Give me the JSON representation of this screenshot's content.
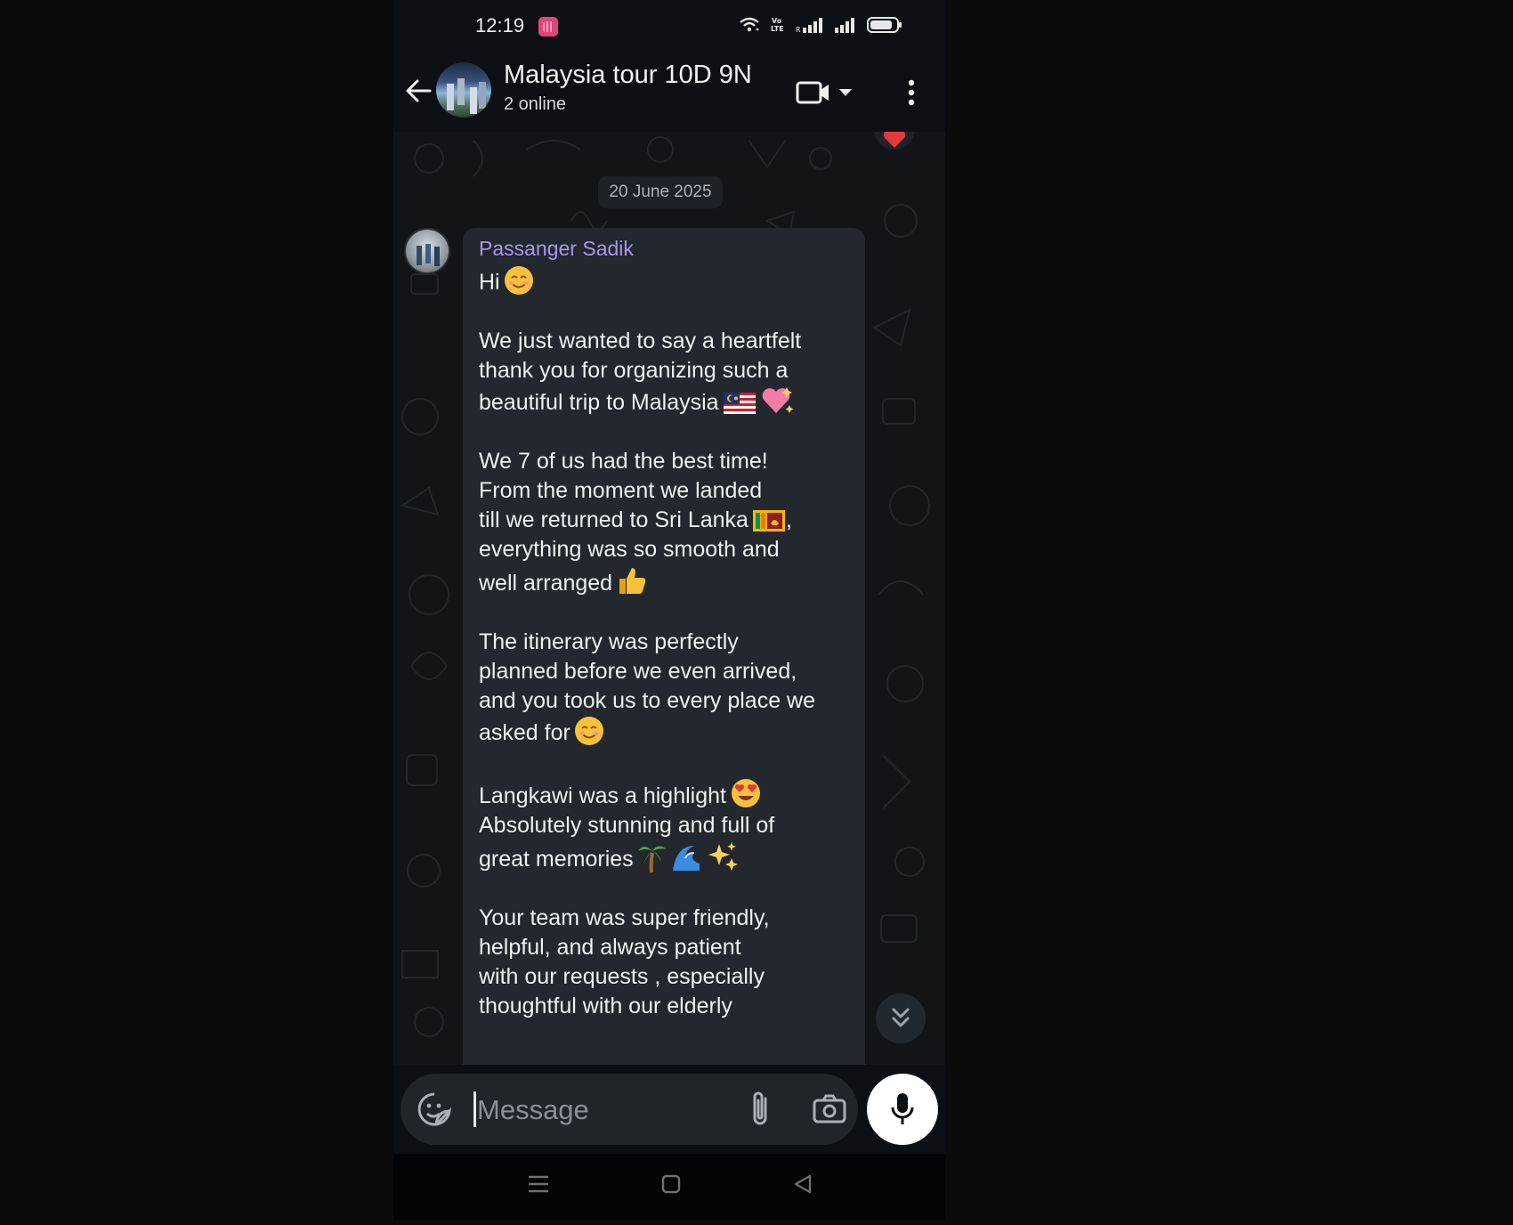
{
  "status_bar": {
    "time": "12:19",
    "icons": [
      "app-notification-icon",
      "wifi-icon",
      "volte-icon",
      "signal-icon",
      "signal-icon",
      "battery-icon"
    ],
    "volte_label": "Vo\nLTE"
  },
  "header": {
    "title": "Malaysia tour 10D 9N",
    "subtitle": "2 online",
    "icons": [
      "back-arrow-icon",
      "group-avatar",
      "video-call-icon",
      "dropdown-caret-icon",
      "more-vert-icon"
    ]
  },
  "chat": {
    "date_chip": "20 June 2025",
    "message": {
      "sender": "Passanger Sadik",
      "paragraphs": [
        {
          "lines": [
            "Hi"
          ],
          "emoji_end": "smiling-face"
        },
        {
          "lines": [
            "We just wanted to say a heartfelt",
            "thank you for organizing such a",
            "beautiful trip to Malaysia"
          ],
          "emoji_end": "malaysia-flag sparkling-heart"
        },
        {
          "lines": [
            "We 7 of us had the best time!",
            "From the moment we landed",
            "till we returned to Sri Lanka",
            "everything was so smooth and",
            "well arranged"
          ],
          "emoji_end": "sri-lanka-flag thumbs-up"
        },
        {
          "lines": [
            "The itinerary was perfectly",
            "planned before we even arrived,",
            "and you took us to every place we",
            "asked for"
          ],
          "emoji_end": "smiling-face"
        },
        {
          "lines": [
            "Langkawi was a highlight",
            "Absolutely stunning and full of",
            "great memories"
          ],
          "emoji_end": "heart-eyes palm-tree wave sparkles"
        },
        {
          "lines": [
            "Your team was super friendly,",
            "helpful, and always patient",
            "with our requests , especially",
            "thoughtful with our elderly"
          ]
        }
      ],
      "sri_lanka_suffix": ","
    },
    "reaction": "red-heart"
  },
  "input_bar": {
    "placeholder": "Message",
    "value": ""
  },
  "colors": {
    "background": "#0c1015",
    "chat_bg": "#121518",
    "bubble": "#22282d",
    "sender_name": "#a994f0",
    "text": "#eef0f1",
    "date_chip": "#1c2226",
    "mic_button": "#ffffff"
  },
  "nav_bar": {
    "icons": [
      "recents-icon",
      "home-icon",
      "back-triangle-icon"
    ]
  }
}
